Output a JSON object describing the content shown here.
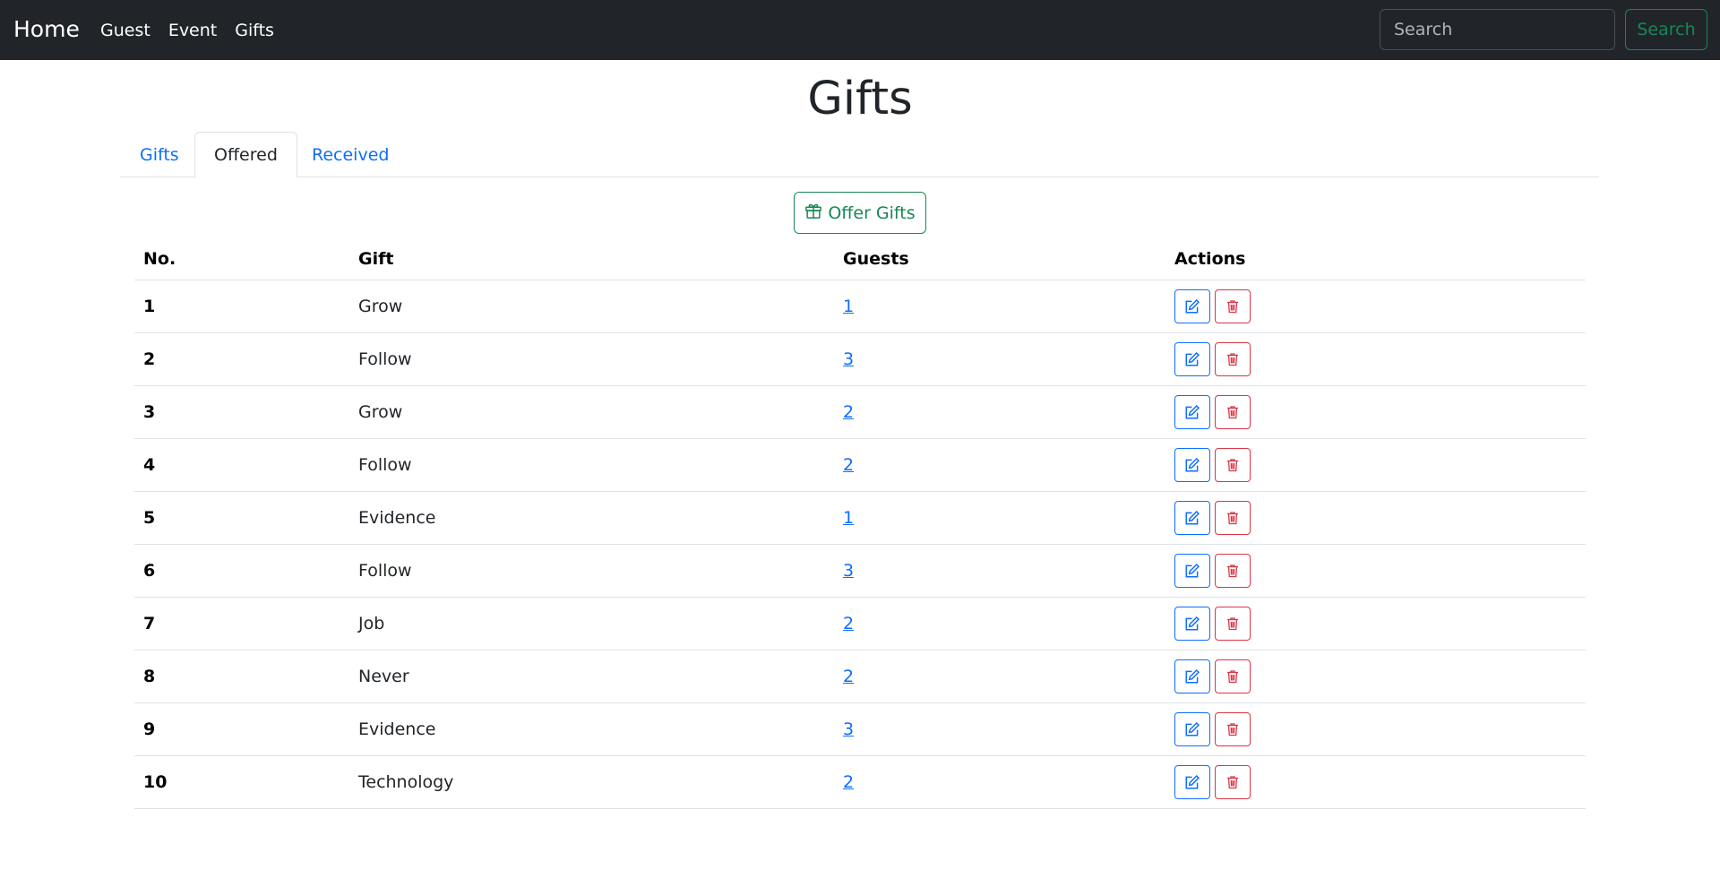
{
  "navbar": {
    "brand": "Home",
    "links": [
      "Guest",
      "Event",
      "Gifts"
    ],
    "search_placeholder": "Search",
    "search_button": "Search"
  },
  "page": {
    "title": "Gifts"
  },
  "tabs": [
    {
      "label": "Gifts",
      "active": false
    },
    {
      "label": "Offered",
      "active": true
    },
    {
      "label": "Received",
      "active": false
    }
  ],
  "offer_button": {
    "label": "Offer Gifts",
    "icon": "gift-icon"
  },
  "table": {
    "headers": [
      "No.",
      "Gift",
      "Guests",
      "Actions"
    ],
    "rows": [
      {
        "no": "1",
        "gift": "Grow",
        "guests": "1"
      },
      {
        "no": "2",
        "gift": "Follow",
        "guests": "3"
      },
      {
        "no": "3",
        "gift": "Grow",
        "guests": "2"
      },
      {
        "no": "4",
        "gift": "Follow",
        "guests": "2"
      },
      {
        "no": "5",
        "gift": "Evidence",
        "guests": "1"
      },
      {
        "no": "6",
        "gift": "Follow",
        "guests": "3"
      },
      {
        "no": "7",
        "gift": "Job",
        "guests": "2"
      },
      {
        "no": "8",
        "gift": "Never",
        "guests": "2"
      },
      {
        "no": "9",
        "gift": "Evidence",
        "guests": "3"
      },
      {
        "no": "10",
        "gift": "Technology",
        "guests": "2"
      }
    ],
    "row_actions": [
      {
        "icon": "edit-icon",
        "color": "#0d6efd"
      },
      {
        "icon": "trash-icon",
        "color": "#dc3545"
      }
    ]
  },
  "colors": {
    "navbar_bg": "#212529",
    "link": "#0d6efd",
    "success": "#198754",
    "danger": "#dc3545"
  }
}
